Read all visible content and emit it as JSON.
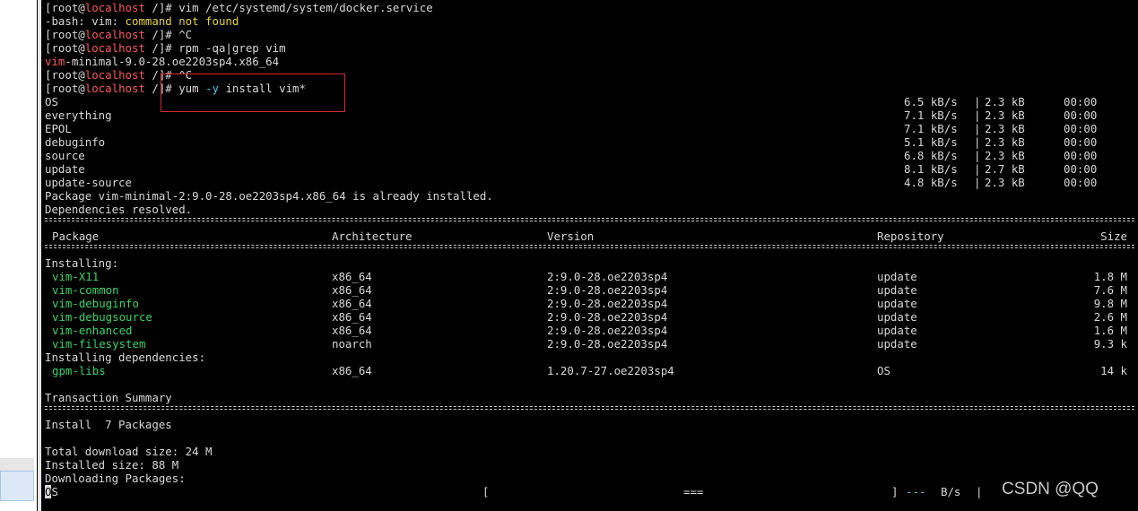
{
  "colors": {
    "background": "#000000",
    "text": "#d8d8d8",
    "hostname_red": "#ff5a5a",
    "keyword_yellow": "#e6d23a",
    "flag_cyan": "#56c7e3",
    "package_green": "#38d46a",
    "highlight_box": "#d62c2c"
  },
  "history": {
    "l1": {
      "prompt_open": "[root@",
      "host": "localhost",
      "prompt_close": " /]# ",
      "cmd": "vim /etc/systemd/system/docker.service"
    },
    "l2": {
      "prefix": "-bash: vim: ",
      "warn": "command not found"
    },
    "l3": {
      "prompt_open": "[root@",
      "host": "localhost",
      "prompt_close": " /]# ",
      "cmd": "^C"
    },
    "l4": {
      "prompt_open": "[root@",
      "host": "localhost",
      "prompt_close": " /]# ",
      "cmd": "rpm -qa|grep vim"
    },
    "l5": {
      "match": "vim",
      "rest": "-minimal-9.0-28.oe2203sp4.x86_64"
    },
    "l6": {
      "prompt_open": "[root@",
      "host": "localhost",
      "prompt_close": " /]# ",
      "cmd": "^C"
    },
    "l7": {
      "prompt_open": "[root@",
      "host": "localhost",
      "prompt_close": " /]# ",
      "cmd_a": "yum ",
      "flag": "-y",
      "cmd_b": " install vim*"
    }
  },
  "repos": [
    {
      "name": "OS",
      "speed": "6.5 kB/s",
      "size": "2.3 kB",
      "time": "00:00"
    },
    {
      "name": "everything",
      "speed": "7.1 kB/s",
      "size": "2.3 kB",
      "time": "00:00"
    },
    {
      "name": "EPOL",
      "speed": "7.1 kB/s",
      "size": "2.3 kB",
      "time": "00:00"
    },
    {
      "name": "debuginfo",
      "speed": "5.1 kB/s",
      "size": "2.3 kB",
      "time": "00:00"
    },
    {
      "name": "source",
      "speed": "6.8 kB/s",
      "size": "2.3 kB",
      "time": "00:00"
    },
    {
      "name": "update",
      "speed": "8.1 kB/s",
      "size": "2.7 kB",
      "time": "00:00"
    },
    {
      "name": "update-source",
      "speed": "4.8 kB/s",
      "size": "2.3 kB",
      "time": "00:00"
    }
  ],
  "msg_already_installed": "Package vim-minimal-2:9.0-28.oe2203sp4.x86_64 is already installed.",
  "msg_deps_resolved": "Dependencies resolved.",
  "headers": {
    "package": "Package",
    "arch": "Architecture",
    "version": "Version",
    "repo": "Repository",
    "size": "Size"
  },
  "section_installing": "Installing:",
  "section_deps": "Installing dependencies:",
  "packages": [
    {
      "name": "vim-X11",
      "arch": "x86_64",
      "version": "2:9.0-28.oe2203sp4",
      "repo": "update",
      "size": "1.8 M"
    },
    {
      "name": "vim-common",
      "arch": "x86_64",
      "version": "2:9.0-28.oe2203sp4",
      "repo": "update",
      "size": "7.6 M"
    },
    {
      "name": "vim-debuginfo",
      "arch": "x86_64",
      "version": "2:9.0-28.oe2203sp4",
      "repo": "update",
      "size": "9.8 M"
    },
    {
      "name": "vim-debugsource",
      "arch": "x86_64",
      "version": "2:9.0-28.oe2203sp4",
      "repo": "update",
      "size": "2.6 M"
    },
    {
      "name": "vim-enhanced",
      "arch": "x86_64",
      "version": "2:9.0-28.oe2203sp4",
      "repo": "update",
      "size": "1.6 M"
    },
    {
      "name": "vim-filesystem",
      "arch": "noarch",
      "version": "2:9.0-28.oe2203sp4",
      "repo": "update",
      "size": "9.3 k"
    }
  ],
  "dependencies": [
    {
      "name": "gpm-libs",
      "arch": "x86_64",
      "version": "1.20.7-27.oe2203sp4",
      "repo": "OS",
      "size": "14 k"
    }
  ],
  "summary": {
    "title": "Transaction Summary",
    "install": "Install  7 Packages",
    "total_download": "Total download size: 24 M",
    "installed_size": "Installed size: 88 M",
    "downloading": "Downloading Packages:"
  },
  "progress": {
    "label_rest": "S",
    "cursor_char": "O",
    "bar_open": "[",
    "bar_fill": "===",
    "bar_close": "]",
    "dashes": "---",
    "rate": "B/s",
    "pipe": "|"
  },
  "watermark": "CSDN @QQ"
}
